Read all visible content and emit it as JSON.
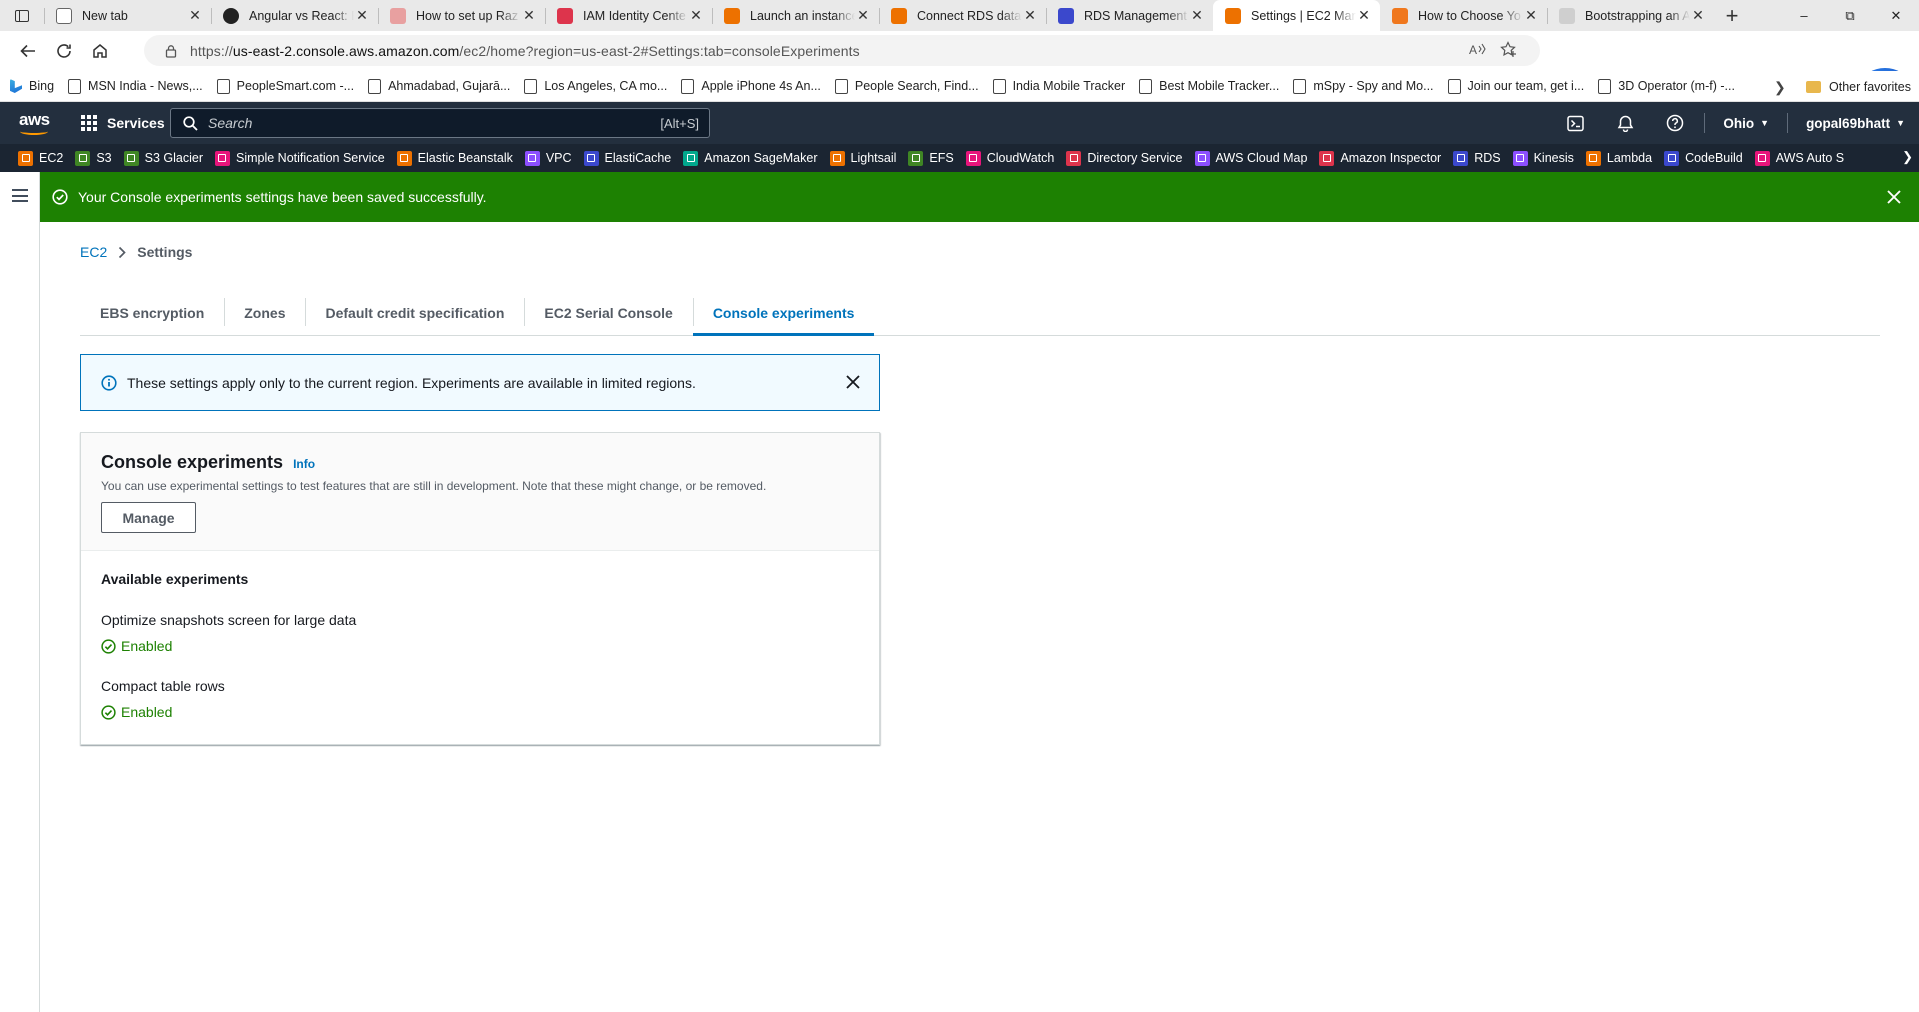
{
  "browser": {
    "tabs": [
      {
        "title": "New tab",
        "icon": "page-icon",
        "color": "#ffffff"
      },
      {
        "title": "Angular vs React: B",
        "icon": "github-icon",
        "color": "#222222"
      },
      {
        "title": "How to set up Raz",
        "icon": "y-icon",
        "color": "#e8a0a0"
      },
      {
        "title": "IAM Identity Cente",
        "icon": "aws-red-icon",
        "color": "#dd344c"
      },
      {
        "title": "Launch an instance",
        "icon": "aws-orange-icon",
        "color": "#ed7100"
      },
      {
        "title": "Connect RDS datab",
        "icon": "aws-orange-icon",
        "color": "#ed7100"
      },
      {
        "title": "RDS Management",
        "icon": "aws-blue-icon",
        "color": "#3b48cc"
      },
      {
        "title": "Settings | EC2 Man",
        "icon": "aws-orange-icon",
        "color": "#ed7100",
        "active": true
      },
      {
        "title": "How to Choose Yo",
        "icon": "cube-icon",
        "color": "#f0781e"
      },
      {
        "title": "Bootstrapping an A",
        "icon": "gray-icon",
        "color": "#cfcfcf"
      }
    ],
    "url_prefix": "https://",
    "url_host": "us-east-2.console.aws.amazon.com",
    "url_path": "/ec2/home?region=us-east-2#Settings:tab=consoleExperiments",
    "bookmarks": [
      "Bing",
      "MSN India - News,...",
      "PeopleSmart.com -...",
      "Ahmadabad, Gujarā...",
      "Los Angeles, CA mo...",
      "Apple iPhone 4s An...",
      "People Search, Find...",
      "India Mobile Tracker",
      "Best Mobile Tracker...",
      "mSpy - Spy and Mo...",
      "Join our team, get i...",
      "3D Operator (m-f) -..."
    ],
    "other_favorites": "Other favorites"
  },
  "aws_nav": {
    "logo": "aws",
    "services": "Services",
    "search_placeholder": "Search",
    "search_shortcut": "[Alt+S]",
    "region": "Ohio",
    "account": "gopal69bhatt",
    "favorites": [
      {
        "label": "EC2",
        "color": "#ed7100"
      },
      {
        "label": "S3",
        "color": "#3f8624"
      },
      {
        "label": "S3 Glacier",
        "color": "#3f8624"
      },
      {
        "label": "Simple Notification Service",
        "color": "#e7157b"
      },
      {
        "label": "Elastic Beanstalk",
        "color": "#ed7100"
      },
      {
        "label": "VPC",
        "color": "#8c4fff"
      },
      {
        "label": "ElastiCache",
        "color": "#3b48cc"
      },
      {
        "label": "Amazon SageMaker",
        "color": "#01a88d"
      },
      {
        "label": "Lightsail",
        "color": "#ed7100"
      },
      {
        "label": "EFS",
        "color": "#3f8624"
      },
      {
        "label": "CloudWatch",
        "color": "#e7157b"
      },
      {
        "label": "Directory Service",
        "color": "#dd344c"
      },
      {
        "label": "AWS Cloud Map",
        "color": "#8c4fff"
      },
      {
        "label": "Amazon Inspector",
        "color": "#dd344c"
      },
      {
        "label": "RDS",
        "color": "#3b48cc"
      },
      {
        "label": "Kinesis",
        "color": "#8c4fff"
      },
      {
        "label": "Lambda",
        "color": "#ed7100"
      },
      {
        "label": "CodeBuild",
        "color": "#3b48cc"
      },
      {
        "label": "AWS Auto S",
        "color": "#e7157b"
      }
    ]
  },
  "flash": {
    "message": "Your Console experiments settings have been saved successfully.",
    "color": "#1d8102"
  },
  "breadcrumb": {
    "root": "EC2",
    "current": "Settings"
  },
  "tabs": [
    {
      "label": "EBS encryption"
    },
    {
      "label": "Zones"
    },
    {
      "label": "Default credit specification"
    },
    {
      "label": "EC2 Serial Console"
    },
    {
      "label": "Console experiments",
      "active": true
    }
  ],
  "info_alert": {
    "message": "These settings apply only to the current region. Experiments are available in limited regions."
  },
  "panel": {
    "title": "Console experiments",
    "info": "Info",
    "description": "You can use experimental settings to test features that are still in development. Note that these might change, or be removed.",
    "manage_label": "Manage",
    "available_title": "Available experiments",
    "experiments": [
      {
        "name": "Optimize snapshots screen for large data",
        "status": "Enabled"
      },
      {
        "name": "Compact table rows",
        "status": "Enabled"
      }
    ]
  }
}
